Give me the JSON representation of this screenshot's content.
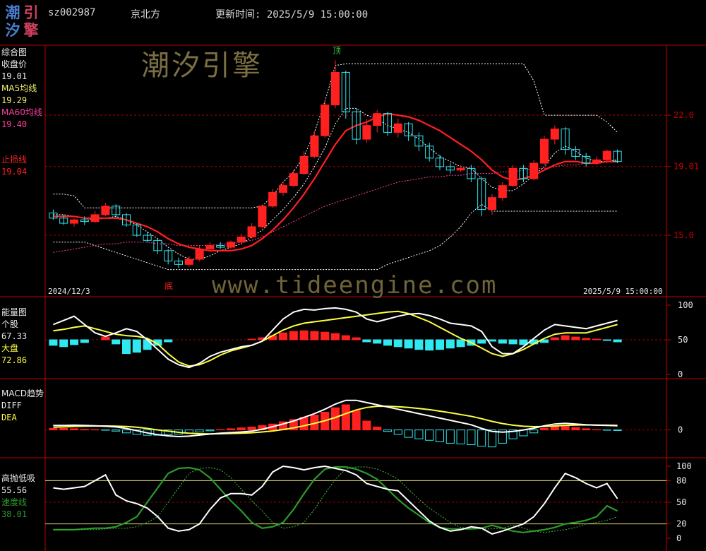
{
  "header": {
    "logo_chars": [
      "潮",
      "引",
      "汐",
      "擎"
    ],
    "code": "sz002987",
    "name": "京北方",
    "update_label": "更新时间: 2025/5/9 15:00:00"
  },
  "watermarks": {
    "cn": "潮汐引擎",
    "url": "www.tideengine.com"
  },
  "colors": {
    "up": "#ff2020",
    "down": "#30e8f0",
    "grid": "#a00000",
    "axis": "#c00000",
    "ma5": "#f0f070",
    "ma60": "#ff3fa0",
    "stop": "#ff2020",
    "white": "#ffffff",
    "yellow": "#ffff40",
    "green": "#2a9a2a",
    "label_white": "#e8e8e8"
  },
  "panels": {
    "main": {
      "labels": [
        "综合图",
        "收盘价",
        "19.01",
        "MA5均线",
        "19.29",
        "MA60均线",
        "19.40",
        "止损线",
        "19.04"
      ],
      "left_date": "2024/12/3",
      "right_date": "2025/5/9 15:00:00",
      "peak_label": "顶",
      "bottom_label": "底"
    },
    "energy": {
      "labels": [
        "能量图",
        "个股",
        "67.33",
        "大盘",
        "72.86"
      ]
    },
    "macd": {
      "labels": [
        "MACD趋势",
        "DIFF",
        "DEA"
      ]
    },
    "tide": {
      "labels": [
        "高抛低吸",
        "55.56",
        "速度线",
        "38.01"
      ]
    }
  },
  "chart_data": [
    {
      "type": "candlestick",
      "panel": "main",
      "ylim": [
        11.5,
        26
      ],
      "y_ticks": [
        22.0,
        19.01,
        15.0
      ],
      "y_tick_labels": [
        "22.0",
        "19.01",
        "15.0"
      ],
      "x_start": "2024/12/3",
      "x_end": "2025/5/9",
      "peak": {
        "index": 27,
        "label": "顶"
      },
      "bottom": {
        "index": 12,
        "label": "底"
      },
      "candles": [
        [
          16.3,
          16.0,
          16.5,
          15.9
        ],
        [
          16.0,
          15.7,
          16.2,
          15.6
        ],
        [
          15.7,
          15.9,
          16.0,
          15.5
        ],
        [
          15.9,
          15.8,
          16.1,
          15.6
        ],
        [
          15.8,
          16.2,
          16.4,
          15.7
        ],
        [
          16.2,
          16.7,
          16.9,
          16.1
        ],
        [
          16.7,
          16.2,
          16.8,
          16.0
        ],
        [
          16.2,
          15.6,
          16.3,
          15.5
        ],
        [
          15.6,
          15.0,
          15.7,
          14.9
        ],
        [
          15.0,
          14.7,
          15.2,
          14.6
        ],
        [
          14.7,
          14.1,
          14.8,
          13.9
        ],
        [
          14.1,
          13.5,
          14.2,
          13.3
        ],
        [
          13.5,
          13.3,
          13.7,
          13.1
        ],
        [
          13.3,
          13.6,
          13.8,
          13.2
        ],
        [
          13.6,
          14.2,
          14.4,
          13.5
        ],
        [
          14.2,
          14.4,
          14.6,
          14.1
        ],
        [
          14.4,
          14.3,
          14.6,
          14.2
        ],
        [
          14.3,
          14.6,
          14.7,
          14.2
        ],
        [
          14.6,
          14.9,
          15.1,
          14.5
        ],
        [
          14.9,
          15.5,
          15.7,
          14.8
        ],
        [
          15.5,
          16.7,
          16.8,
          15.4
        ],
        [
          16.7,
          17.5,
          17.7,
          16.6
        ],
        [
          17.5,
          17.9,
          18.1,
          17.3
        ],
        [
          17.9,
          18.6,
          18.8,
          17.8
        ],
        [
          18.6,
          19.6,
          19.9,
          18.5
        ],
        [
          19.6,
          20.8,
          21.1,
          19.5
        ],
        [
          20.8,
          22.6,
          22.9,
          20.7
        ],
        [
          22.6,
          24.5,
          25.2,
          22.4
        ],
        [
          24.5,
          22.2,
          24.6,
          21.8
        ],
        [
          22.2,
          20.6,
          22.4,
          20.3
        ],
        [
          20.6,
          21.4,
          21.8,
          20.4
        ],
        [
          21.4,
          22.1,
          22.3,
          21.0
        ],
        [
          22.1,
          21.0,
          22.2,
          20.8
        ],
        [
          21.0,
          21.5,
          21.8,
          20.7
        ],
        [
          21.5,
          20.8,
          21.6,
          20.5
        ],
        [
          20.8,
          20.2,
          21.0,
          19.9
        ],
        [
          20.2,
          19.5,
          20.4,
          19.3
        ],
        [
          19.5,
          19.0,
          19.7,
          18.8
        ],
        [
          19.0,
          18.8,
          19.2,
          18.6
        ],
        [
          18.8,
          18.9,
          19.1,
          18.7
        ],
        [
          18.9,
          18.3,
          19.1,
          18.1
        ],
        [
          18.3,
          16.5,
          18.4,
          16.1
        ],
        [
          16.5,
          17.2,
          17.4,
          16.2
        ],
        [
          17.2,
          17.9,
          18.1,
          17.0
        ],
        [
          17.9,
          18.9,
          19.1,
          17.8
        ],
        [
          18.9,
          18.3,
          19.1,
          18.1
        ],
        [
          18.3,
          19.2,
          19.4,
          18.2
        ],
        [
          19.2,
          20.6,
          20.8,
          19.1
        ],
        [
          20.6,
          21.2,
          21.4,
          20.3
        ],
        [
          21.2,
          20.0,
          21.3,
          19.7
        ],
        [
          20.0,
          19.6,
          20.2,
          19.4
        ],
        [
          19.6,
          19.2,
          19.8,
          19.0
        ],
        [
          19.2,
          19.4,
          19.6,
          19.1
        ],
        [
          19.4,
          19.9,
          20.0,
          19.2
        ],
        [
          19.9,
          19.3,
          20.0,
          19.2
        ]
      ],
      "ma_red": [
        16.1,
        16.1,
        16.1,
        16.0,
        16.0,
        16.0,
        16.0,
        15.9,
        15.7,
        15.5,
        15.2,
        14.8,
        14.5,
        14.3,
        14.2,
        14.1,
        14.1,
        14.1,
        14.2,
        14.4,
        14.8,
        15.3,
        15.9,
        16.6,
        17.4,
        18.3,
        19.3,
        20.3,
        21.1,
        21.4,
        21.6,
        21.9,
        22.1,
        22.0,
        21.9,
        21.7,
        21.4,
        21.1,
        20.7,
        20.3,
        19.9,
        19.4,
        18.8,
        18.4,
        18.2,
        18.3,
        18.5,
        18.8,
        19.1,
        19.3,
        19.3,
        19.2,
        19.2,
        19.3,
        19.3
      ],
      "ma_white": [
        16.2,
        16.2,
        16.1,
        16.0,
        15.9,
        16.0,
        16.1,
        15.9,
        15.6,
        15.2,
        14.8,
        14.3,
        13.9,
        13.6,
        13.6,
        13.8,
        14.1,
        14.3,
        14.5,
        14.9,
        15.3,
        15.9,
        16.5,
        17.2,
        18.0,
        19.0,
        20.1,
        21.5,
        22.4,
        22.4,
        22.0,
        21.8,
        21.4,
        21.2,
        21.0,
        20.6,
        20.1,
        19.6,
        19.3,
        19.0,
        18.9,
        18.3,
        17.8,
        17.6,
        17.6,
        18.0,
        18.5,
        19.0,
        19.8,
        20.2,
        19.9,
        19.5,
        19.3,
        19.3,
        19.4
      ],
      "ma60": [
        14.0,
        14.1,
        14.2,
        14.3,
        14.4,
        14.5,
        14.5,
        14.6,
        14.6,
        14.6,
        14.5,
        14.5,
        14.4,
        14.4,
        14.4,
        14.4,
        14.5,
        14.5,
        14.6,
        14.7,
        14.9,
        15.2,
        15.5,
        15.8,
        16.1,
        16.4,
        16.7,
        16.9,
        17.1,
        17.3,
        17.5,
        17.7,
        17.9,
        18.1,
        18.2,
        18.3,
        18.4,
        18.4,
        18.5,
        18.5,
        18.6,
        18.6,
        18.6,
        18.7,
        18.7,
        18.8,
        18.9,
        18.9,
        19.0,
        19.1,
        19.1,
        19.2,
        19.2,
        19.3,
        19.4
      ],
      "band_upper": [
        17.4,
        17.4,
        17.3,
        16.6,
        16.6,
        16.6,
        16.6,
        16.6,
        16.6,
        16.6,
        16.6,
        16.6,
        16.6,
        16.6,
        16.6,
        16.6,
        16.6,
        16.6,
        16.6,
        16.6,
        16.7,
        17.3,
        18.1,
        18.7,
        19.6,
        21.0,
        22.8,
        24.9,
        25.0,
        25.0,
        25.0,
        25.0,
        25.0,
        25.0,
        25.0,
        25.0,
        25.0,
        25.0,
        25.0,
        25.0,
        25.0,
        25.0,
        25.0,
        25.0,
        25.0,
        25.0,
        24.0,
        22.0,
        22.0,
        22.0,
        22.0,
        22.0,
        22.0,
        21.6,
        21.0
      ],
      "band_lower": [
        14.6,
        14.6,
        14.6,
        14.6,
        14.4,
        14.2,
        14.0,
        13.8,
        13.6,
        13.4,
        13.2,
        13.0,
        13.0,
        13.0,
        13.0,
        13.0,
        13.0,
        13.0,
        13.0,
        13.0,
        13.0,
        13.0,
        13.0,
        13.0,
        13.0,
        13.0,
        13.0,
        13.0,
        13.0,
        13.0,
        13.0,
        13.0,
        13.3,
        13.5,
        13.7,
        13.9,
        14.1,
        14.4,
        14.9,
        15.5,
        16.3,
        16.8,
        16.4,
        16.4,
        16.4,
        16.4,
        16.4,
        16.4,
        16.4,
        16.4,
        16.4,
        16.4,
        16.4,
        16.4,
        16.4
      ]
    },
    {
      "type": "line+bar",
      "panel": "energy",
      "ylim": [
        0,
        100
      ],
      "y_ticks": [
        100,
        50,
        0
      ],
      "series": [
        {
          "name": "个股",
          "values": [
            72,
            78,
            84,
            72,
            60,
            55,
            60,
            66,
            62,
            50,
            36,
            22,
            14,
            10,
            16,
            26,
            32,
            36,
            40,
            42,
            48,
            64,
            80,
            90,
            94,
            93,
            95,
            96,
            94,
            90,
            80,
            76,
            80,
            84,
            87,
            88,
            85,
            80,
            74,
            72,
            70,
            62,
            40,
            30,
            30,
            40,
            52,
            64,
            72,
            70,
            68,
            66,
            70,
            74,
            78
          ]
        },
        {
          "name": "大盘",
          "values": [
            63,
            65,
            68,
            70,
            66,
            62,
            58,
            56,
            55,
            52,
            44,
            30,
            18,
            12,
            14,
            20,
            28,
            34,
            38,
            42,
            48,
            56,
            64,
            70,
            74,
            76,
            78,
            80,
            82,
            84,
            86,
            88,
            90,
            91,
            88,
            82,
            76,
            68,
            60,
            52,
            46,
            38,
            30,
            26,
            30,
            36,
            44,
            52,
            58,
            60,
            60,
            60,
            64,
            68,
            72
          ]
        }
      ],
      "bars": [
        -8,
        -10,
        -7,
        -4,
        0,
        4,
        -6,
        -20,
        -18,
        -14,
        -8,
        -3,
        0,
        0,
        0,
        0,
        0,
        0,
        0,
        1,
        3,
        6,
        10,
        12,
        13,
        12,
        11,
        9,
        6,
        3,
        -3,
        -5,
        -8,
        -10,
        -12,
        -14,
        -15,
        -14,
        -12,
        -10,
        -8,
        -5,
        -2,
        -5,
        -6,
        -7,
        -6,
        -4,
        3,
        6,
        4,
        2,
        1,
        -1,
        -3
      ]
    },
    {
      "type": "line+bar",
      "panel": "macd",
      "ylim": [
        -1.5,
        2.8
      ],
      "y_ticks": [
        0
      ],
      "series": [
        {
          "name": "DIFF",
          "values": [
            0.3,
            0.3,
            0.32,
            0.3,
            0.28,
            0.25,
            0.2,
            0.1,
            -0.05,
            -0.2,
            -0.32,
            -0.4,
            -0.45,
            -0.42,
            -0.35,
            -0.28,
            -0.22,
            -0.18,
            -0.14,
            -0.08,
            0.05,
            0.22,
            0.4,
            0.6,
            0.85,
            1.1,
            1.4,
            1.75,
            2.0,
            2.0,
            1.85,
            1.7,
            1.55,
            1.4,
            1.25,
            1.1,
            0.95,
            0.8,
            0.65,
            0.5,
            0.35,
            0.1,
            -0.1,
            -0.15,
            -0.1,
            0.0,
            0.12,
            0.28,
            0.4,
            0.45,
            0.4,
            0.35,
            0.32,
            0.3,
            0.28
          ]
        },
        {
          "name": "DEA",
          "values": [
            0.18,
            0.2,
            0.24,
            0.26,
            0.27,
            0.27,
            0.26,
            0.23,
            0.18,
            0.1,
            0.0,
            -0.08,
            -0.16,
            -0.22,
            -0.26,
            -0.27,
            -0.26,
            -0.24,
            -0.22,
            -0.19,
            -0.14,
            -0.07,
            0.03,
            0.14,
            0.28,
            0.44,
            0.62,
            0.84,
            1.1,
            1.35,
            1.52,
            1.6,
            1.6,
            1.57,
            1.52,
            1.45,
            1.37,
            1.27,
            1.16,
            1.04,
            0.92,
            0.76,
            0.58,
            0.43,
            0.32,
            0.25,
            0.22,
            0.23,
            0.27,
            0.31,
            0.33,
            0.34,
            0.33,
            0.32,
            0.31
          ]
        }
      ],
      "bars": [
        0.1,
        0.1,
        0.08,
        0.04,
        0.02,
        -0.02,
        -0.08,
        -0.2,
        -0.3,
        -0.36,
        -0.36,
        -0.32,
        -0.28,
        -0.22,
        -0.14,
        -0.06,
        0.02,
        0.08,
        0.14,
        0.2,
        0.3,
        0.4,
        0.55,
        0.7,
        0.85,
        1.0,
        1.2,
        1.5,
        1.7,
        1.3,
        0.6,
        0.2,
        -0.1,
        -0.3,
        -0.5,
        -0.6,
        -0.7,
        -0.8,
        -0.9,
        -0.95,
        -1.0,
        -1.1,
        -1.15,
        -0.9,
        -0.6,
        -0.4,
        -0.2,
        0.1,
        0.28,
        0.3,
        0.16,
        0.08,
        0.02,
        -0.02,
        -0.04
      ]
    },
    {
      "type": "line",
      "panel": "tide",
      "ylim": [
        0,
        100
      ],
      "y_ticks": [
        100,
        80,
        50,
        20,
        0
      ],
      "series": [
        {
          "name": "高抛低吸",
          "values": [
            70,
            68,
            70,
            72,
            80,
            88,
            60,
            52,
            48,
            42,
            30,
            14,
            10,
            12,
            20,
            40,
            56,
            62,
            62,
            60,
            72,
            92,
            100,
            98,
            95,
            98,
            100,
            97,
            94,
            88,
            76,
            72,
            68,
            66,
            52,
            38,
            24,
            15,
            10,
            12,
            16,
            14,
            6,
            10,
            15,
            20,
            30,
            48,
            70,
            90,
            84,
            76,
            70,
            76,
            55
          ]
        },
        {
          "name": "速度线",
          "values": [
            12,
            12,
            12,
            13,
            14,
            14,
            16,
            22,
            30,
            50,
            70,
            90,
            97,
            98,
            95,
            84,
            68,
            52,
            38,
            22,
            14,
            16,
            22,
            40,
            62,
            82,
            96,
            99,
            99,
            96,
            90,
            82,
            68,
            54,
            42,
            32,
            22,
            15,
            13,
            13,
            13,
            14,
            18,
            14,
            10,
            8,
            10,
            12,
            15,
            20,
            22,
            25,
            30,
            45,
            38
          ]
        }
      ]
    }
  ]
}
